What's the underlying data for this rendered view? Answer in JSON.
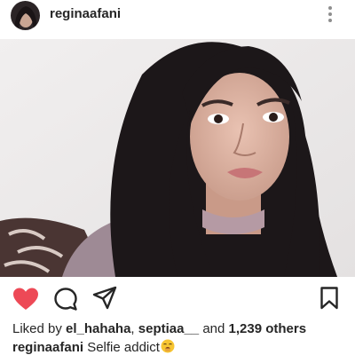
{
  "post": {
    "username": "reginaafani",
    "more_icon": "more-vertical-icon",
    "avatar_icon": "profile-avatar-icon",
    "photo_icon": "post-photo-selfie"
  },
  "actions": {
    "like_icon": "heart-filled-icon",
    "like_color": "#ed4956",
    "comment_icon": "comment-icon",
    "share_icon": "direct-share-icon",
    "save_icon": "bookmark-icon"
  },
  "likes": {
    "prefix": "Liked by ",
    "user1": "el_hahaha",
    "separator": ", ",
    "user2": "septiaa__",
    "and": " and ",
    "others": "1,239 others"
  },
  "caption": {
    "username": "reginaafani",
    "text": " Selfie addict",
    "emoji_icon": "yawning-face-emoji-icon"
  }
}
